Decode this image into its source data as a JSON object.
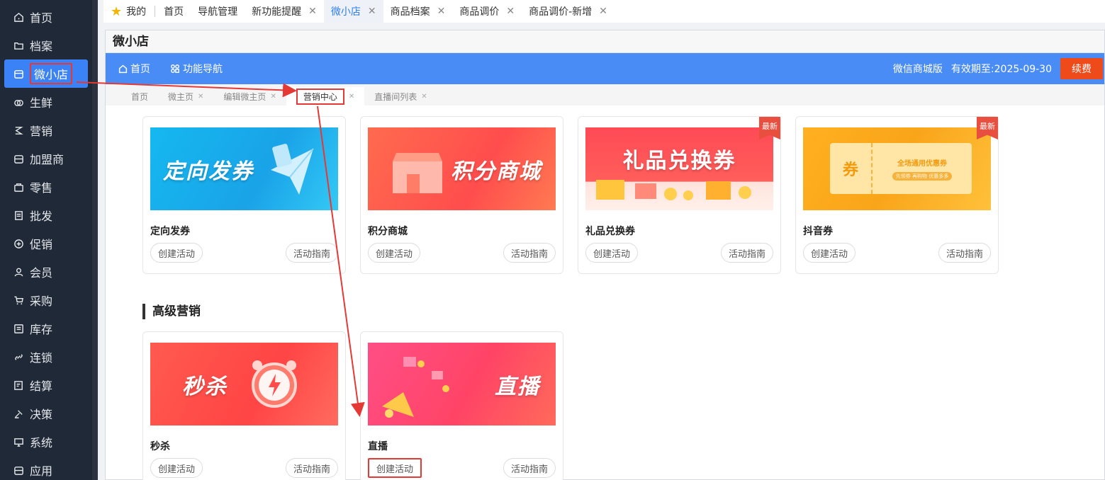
{
  "sidebar": {
    "items": [
      {
        "label": "首页",
        "icon": "home-icon"
      },
      {
        "label": "档案",
        "icon": "folder-icon"
      },
      {
        "label": "微小店",
        "icon": "shop-icon"
      },
      {
        "label": "生鲜",
        "icon": "fruit-icon"
      },
      {
        "label": "营销",
        "icon": "marketing-icon"
      },
      {
        "label": "加盟商",
        "icon": "store-icon"
      },
      {
        "label": "零售",
        "icon": "bag-icon"
      },
      {
        "label": "批发",
        "icon": "wholesale-icon"
      },
      {
        "label": "促销",
        "icon": "promo-icon"
      },
      {
        "label": "会员",
        "icon": "user-icon"
      },
      {
        "label": "采购",
        "icon": "cart-icon"
      },
      {
        "label": "库存",
        "icon": "inventory-icon"
      },
      {
        "label": "连锁",
        "icon": "link-icon"
      },
      {
        "label": "结算",
        "icon": "settle-icon"
      },
      {
        "label": "决策",
        "icon": "gavel-icon"
      },
      {
        "label": "系统",
        "icon": "monitor-icon"
      },
      {
        "label": "应用",
        "icon": "app-icon"
      }
    ]
  },
  "toptabs": {
    "mine": "我的",
    "tabs": [
      "首页",
      "导航管理",
      "新功能提醒",
      "微小店",
      "商品档案",
      "商品调价",
      "商品调价-新增"
    ]
  },
  "panel": {
    "title": "微小店",
    "nav_home": "首页",
    "nav_func": "功能导航",
    "edition": "微信商城版",
    "expiry": "有效期至:2025-09-30",
    "renew": "续费"
  },
  "subtabs": [
    "首页",
    "微主页",
    "编辑微主页",
    "营销中心",
    "直播间列表"
  ],
  "cards_row1": [
    {
      "name": "定向发券",
      "banner": "定向发券",
      "create": "创建活动",
      "guide": "活动指南"
    },
    {
      "name": "积分商城",
      "banner": "积分商城",
      "create": "创建活动",
      "guide": "活动指南"
    },
    {
      "name": "礼品兑换券",
      "banner": "礼品兑换券",
      "create": "创建活动",
      "guide": "活动指南",
      "tag": "最新"
    },
    {
      "name": "抖音券",
      "banner": "券",
      "banner_sub": "全场通用优惠券",
      "banner_sub2": "先领券 再购物 优惠多多",
      "create": "创建活动",
      "guide": "活动指南",
      "tag": "最新"
    }
  ],
  "section_title": "高级营销",
  "cards_row2": [
    {
      "name": "秒杀",
      "banner": "秒杀",
      "create": "创建活动",
      "guide": "活动指南"
    },
    {
      "name": "直播",
      "banner": "直播",
      "create": "创建活动",
      "guide": "活动指南"
    }
  ],
  "colors": {
    "sidebar_bg": "#1f2937",
    "accent_blue": "#4a8cf6",
    "renew_orange": "#ef4a19",
    "highlight_red": "#e53935"
  }
}
